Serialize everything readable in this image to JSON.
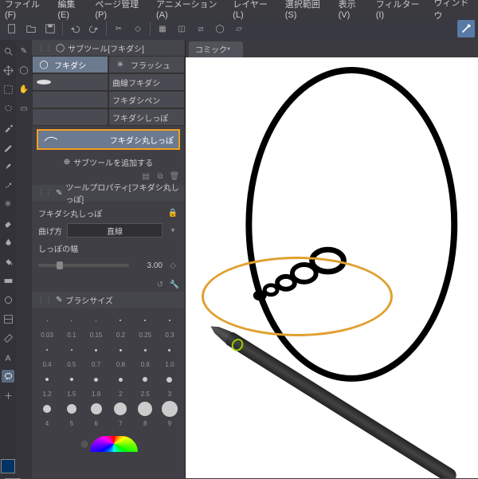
{
  "menu": [
    "ファイル(F)",
    "編集(E)",
    "ページ管理(P)",
    "アニメーション(A)",
    "レイヤー(L)",
    "選択範囲(S)",
    "表示(V)",
    "フィルター(I)",
    "ウィンドウ"
  ],
  "tab": "コミック*",
  "subtool_panel": {
    "title": "サブツール[フキダシ]",
    "items": [
      {
        "label": "フキダシ",
        "sel": true
      },
      {
        "label": "フラッシュ"
      },
      {
        "label": ""
      },
      {
        "label": "曲線フキダシ"
      },
      {
        "label": ""
      },
      {
        "label": "フキダシペン"
      },
      {
        "label": ""
      },
      {
        "label": "フキダシしっぽ"
      }
    ],
    "highlight": "フキダシ丸しっぽ",
    "add": "サブツールを追加する"
  },
  "prop_panel": {
    "title": "ツールプロパティ[フキダシ丸しっぽ]",
    "name": "フキダシ丸しっぽ",
    "rows": [
      {
        "label": "曲げ方",
        "value": "直線"
      },
      {
        "label": "しっぽの幅",
        "value": "3.00"
      }
    ]
  },
  "brush_panel": {
    "title": "ブラシサイズ",
    "rows": [
      [
        "0.03",
        "0.1",
        "0.15",
        "0.2",
        "0.25",
        "0.3"
      ],
      [
        "0.4",
        "0.5",
        "0.7",
        "0.8",
        "0.9",
        "1.0"
      ],
      [
        "1.2",
        "1.5",
        "1.8",
        "2",
        "2.5",
        "3"
      ],
      [
        "4",
        "5",
        "6",
        "7",
        "8",
        "9"
      ]
    ],
    "dot_sizes": [
      [
        1,
        1,
        1,
        2,
        2,
        2
      ],
      [
        2,
        2,
        3,
        3,
        3,
        3
      ],
      [
        4,
        4,
        5,
        5,
        6,
        7
      ],
      [
        10,
        12,
        14,
        16,
        18,
        20
      ]
    ]
  }
}
